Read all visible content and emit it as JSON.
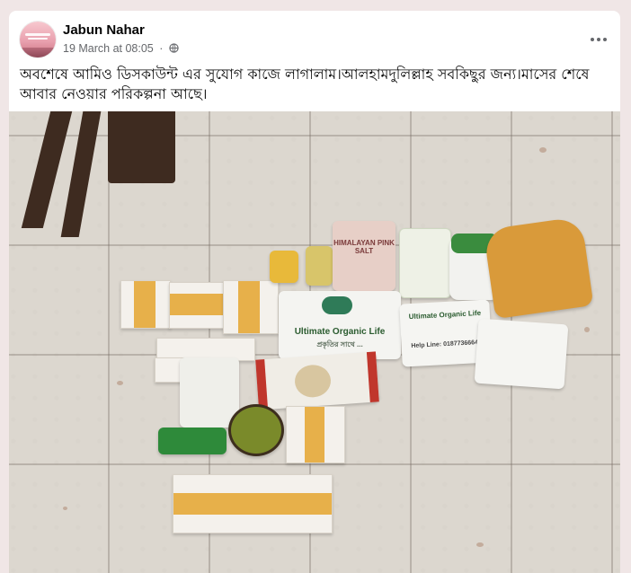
{
  "post": {
    "author": "Jabun Nahar",
    "timestamp": "19 March at 08:05",
    "separator": "·",
    "privacy_icon": "globe-icon",
    "more_icon": "more-options-icon",
    "text": "অবশেষে আমিও ডিসকাউন্ট এর সুযোগ কাজে লাগালাম।আলহামদুলিল্লাহ সবকিছুর জন্য।মাসের শেষে আবার নেওয়ার পরিকল্পনা আছে।"
  },
  "photo": {
    "products": {
      "big_bag_line1": "Ultimate Organic Life",
      "big_bag_line2": "প্রকৃতির সাথে ...",
      "himalayan_label": "HIMALAYAN PINK SALT",
      "pack_label": "Ultimate Organic Life",
      "pack_note": "Help Line: 01877366645"
    }
  },
  "colors": {
    "author_text": "#050505",
    "meta_text": "#65676b",
    "tape": "#e7b04a",
    "floor": "#dcd7cf",
    "page_bg": "#f0e6e6"
  }
}
